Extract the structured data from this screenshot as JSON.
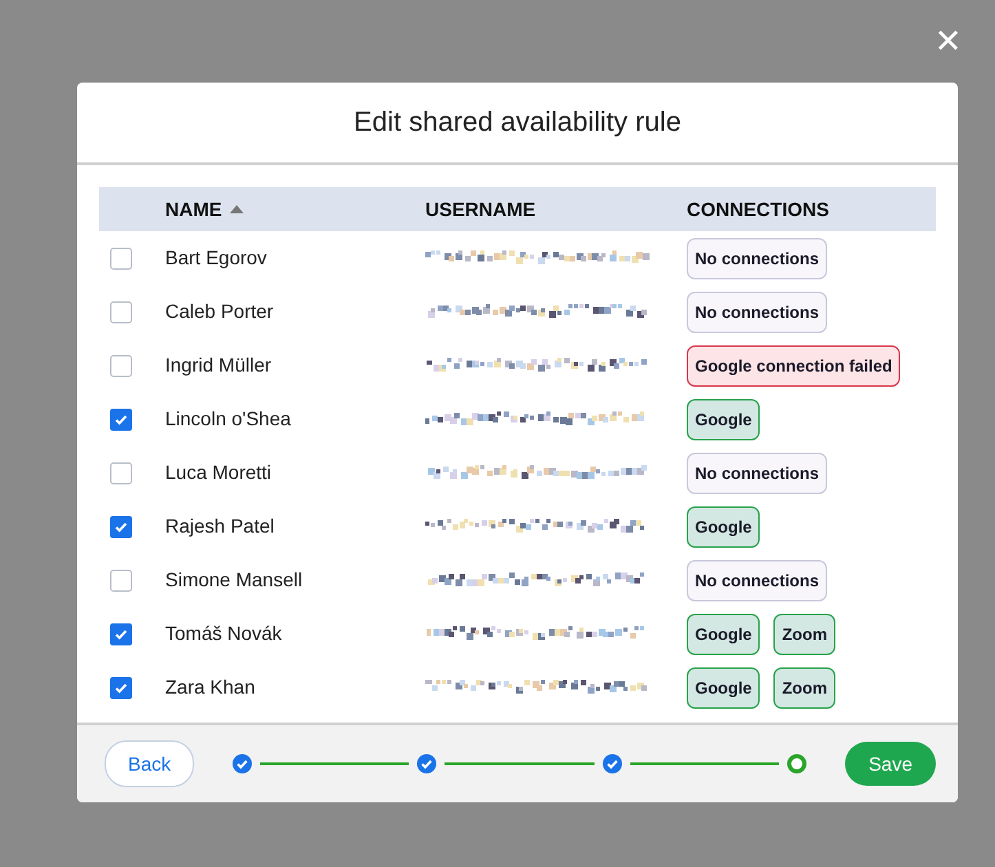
{
  "close_label": "✕",
  "dialog": {
    "title": "Edit shared availability rule",
    "table": {
      "columns": [
        {
          "label": "NAME",
          "sorted": true
        },
        {
          "label": "USERNAME",
          "sorted": false
        },
        {
          "label": "CONNECTIONS",
          "sorted": false
        }
      ],
      "rows": [
        {
          "checked": false,
          "name": "Bart Egorov",
          "connections": [
            {
              "label": "No connections",
              "kind": "none"
            }
          ]
        },
        {
          "checked": false,
          "name": "Caleb Porter",
          "connections": [
            {
              "label": "No connections",
              "kind": "none"
            }
          ]
        },
        {
          "checked": false,
          "name": "Ingrid Müller",
          "connections": [
            {
              "label": "Google connection failed",
              "kind": "failed"
            }
          ]
        },
        {
          "checked": true,
          "name": "Lincoln o'Shea",
          "connections": [
            {
              "label": "Google",
              "kind": "ok"
            }
          ]
        },
        {
          "checked": false,
          "name": "Luca Moretti",
          "connections": [
            {
              "label": "No connections",
              "kind": "none"
            }
          ]
        },
        {
          "checked": true,
          "name": "Rajesh Patel",
          "connections": [
            {
              "label": "Google",
              "kind": "ok"
            }
          ]
        },
        {
          "checked": false,
          "name": "Simone Mansell",
          "connections": [
            {
              "label": "No connections",
              "kind": "none"
            }
          ]
        },
        {
          "checked": true,
          "name": "Tomáš Novák",
          "connections": [
            {
              "label": "Google",
              "kind": "ok"
            },
            {
              "label": "Zoom",
              "kind": "ok"
            }
          ]
        },
        {
          "checked": true,
          "name": "Zara Khan",
          "connections": [
            {
              "label": "Google",
              "kind": "ok"
            },
            {
              "label": "Zoom",
              "kind": "ok"
            }
          ]
        }
      ]
    },
    "footer": {
      "back": "Back",
      "save": "Save",
      "steps": [
        {
          "done": true
        },
        {
          "done": true
        },
        {
          "done": true
        },
        {
          "done": false
        }
      ]
    }
  }
}
